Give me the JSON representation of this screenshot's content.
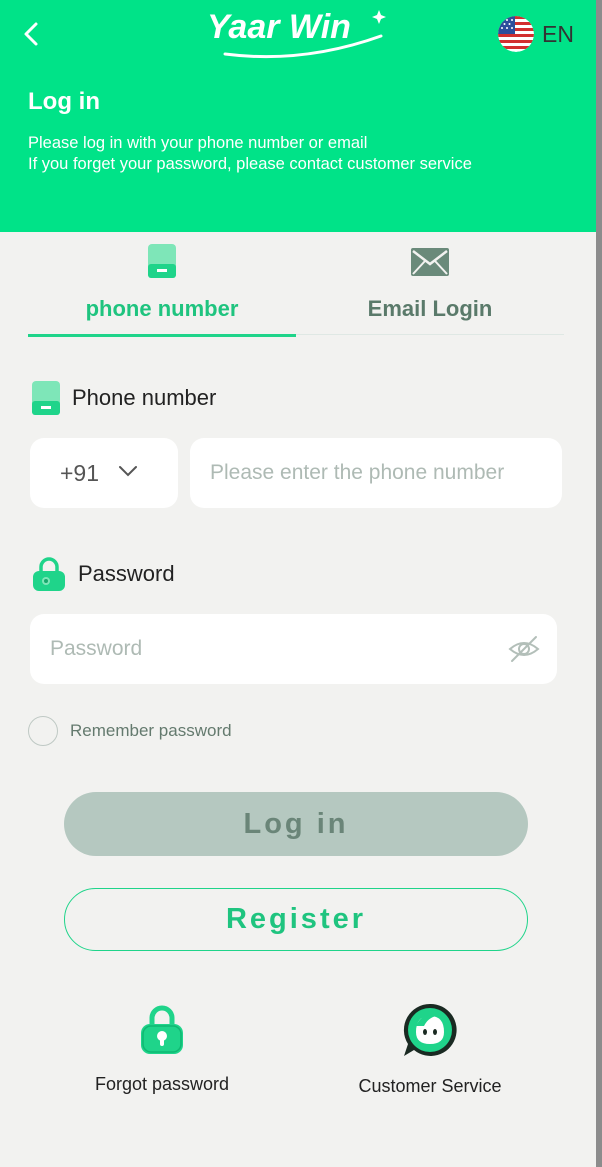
{
  "header": {
    "logo_text": "Yaar Win",
    "language": "EN",
    "title": "Log in",
    "desc_line1": "Please log in with your phone number or email",
    "desc_line2": "If you forget your password, please contact customer service"
  },
  "tabs": [
    {
      "label": "phone number",
      "icon": "phone-icon",
      "active": true
    },
    {
      "label": "Email Login",
      "icon": "email-icon",
      "active": false
    }
  ],
  "phone_field": {
    "label": "Phone number",
    "country_code": "+91",
    "placeholder": "Please enter the phone number"
  },
  "password_field": {
    "label": "Password",
    "placeholder": "Password"
  },
  "remember_label": "Remember password",
  "login_button": "Log in",
  "register_button": "Register",
  "bottom": {
    "forgot_label": "Forgot password",
    "service_label": "Customer Service"
  },
  "colors": {
    "brand": "#00e388",
    "accent": "#1fc47f",
    "background": "#f2f2f0",
    "login_button_bg": "#b5c8c0"
  }
}
